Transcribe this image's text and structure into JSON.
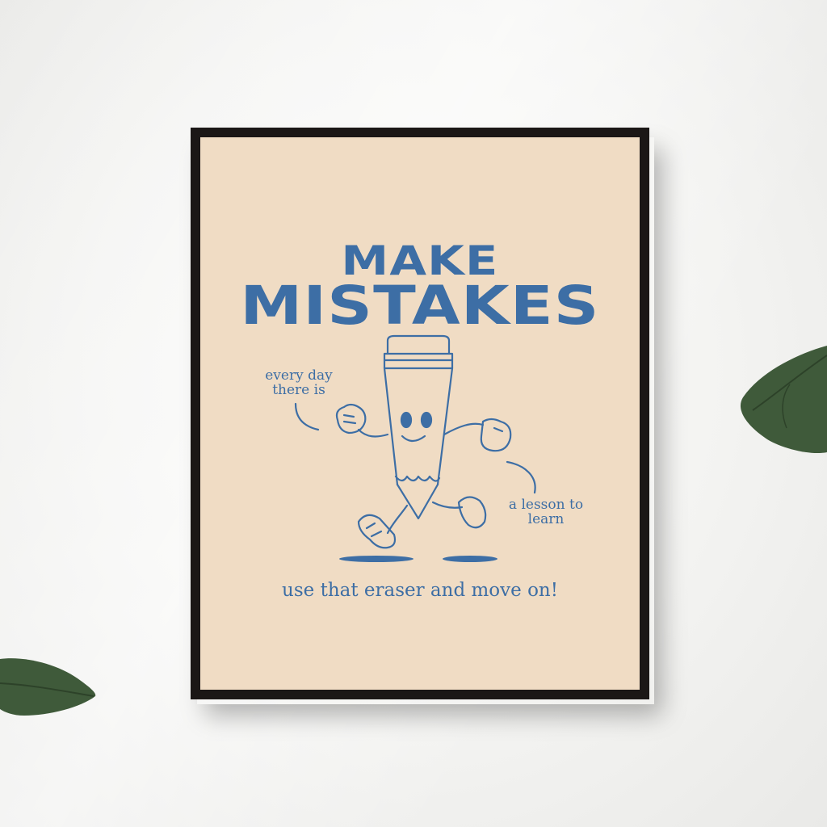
{
  "poster": {
    "headline_line1": "MAKE",
    "headline_line2": "MISTAKES",
    "note_left": "every day there is",
    "note_right": "a lesson to learn",
    "tagline": "use that eraser and move on!"
  },
  "colors": {
    "ink_blue": "#3d6ea5",
    "poster_background": "#f0dcc4",
    "frame": "#1b1716",
    "wall": "#f4f4f2",
    "leaf_green": "#3f5a3a"
  },
  "icons": {
    "character": "pencil-character-icon",
    "leaves": "leaf-icon"
  }
}
